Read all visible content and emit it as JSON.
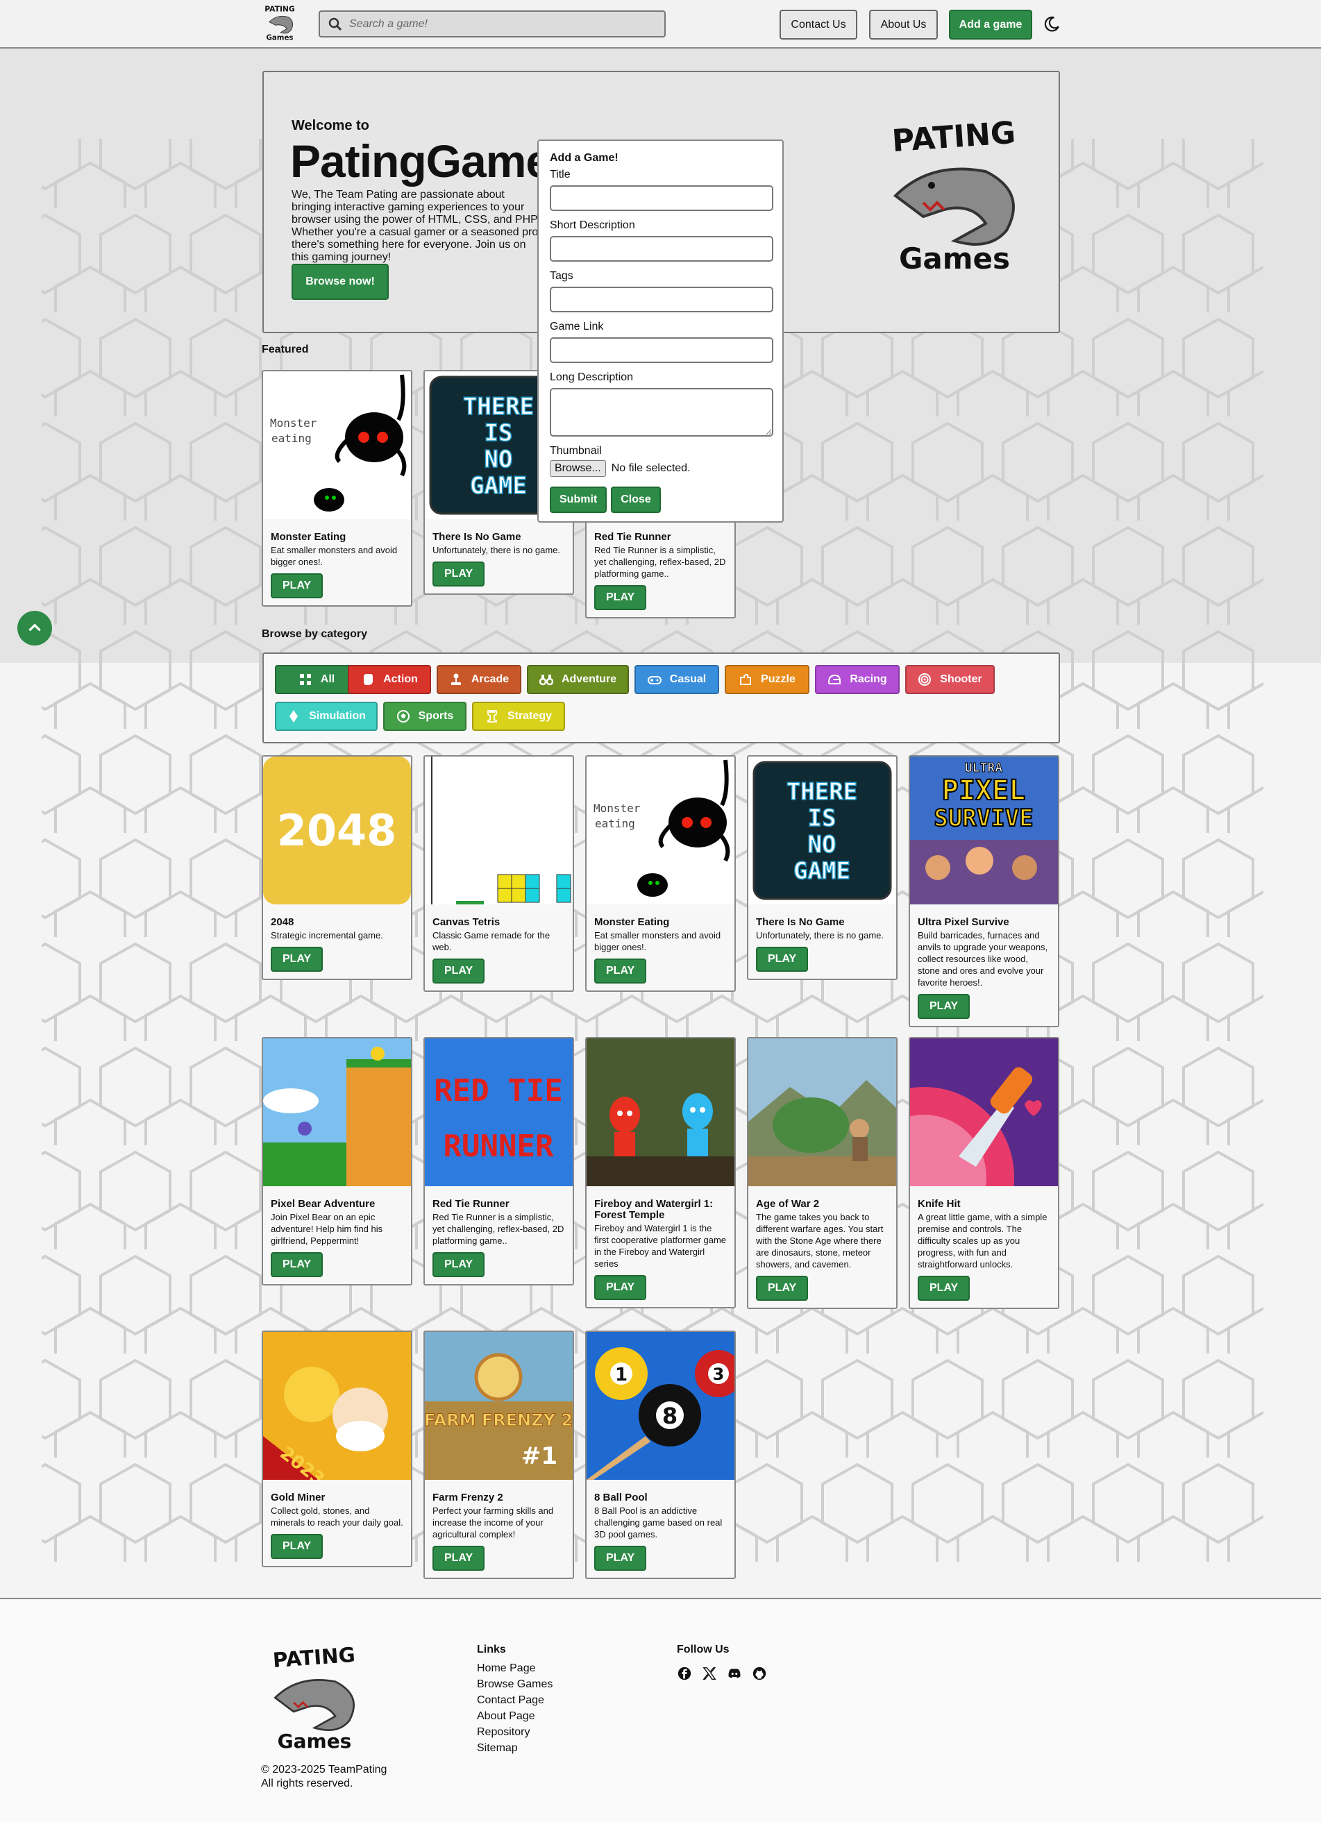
{
  "header": {
    "search_placeholder": "Search a game!",
    "contact_label": "Contact Us",
    "about_label": "About Us",
    "add_label": "Add a game"
  },
  "hero": {
    "welcome": "Welcome to",
    "title": "PatingGames",
    "text": "We, The Team Pating are passionate about bringing interactive gaming experiences to your browser using the power of HTML, CSS, and PHP. Whether you're a casual gamer or a seasoned pro, there's something here for everyone. Join us on this gaming journey!",
    "button": "Browse now!"
  },
  "modal": {
    "title": "Add a Game!",
    "label_title": "Title",
    "label_short": "Short Description",
    "label_tags": "Tags",
    "label_link": "Game Link",
    "label_long": "Long Description",
    "label_thumb": "Thumbnail",
    "browse": "Browse...",
    "no_file": "No file selected.",
    "submit": "Submit",
    "close": "Close"
  },
  "featured_label": "Featured",
  "featured": [
    {
      "title": "Monster Eating",
      "desc": "Eat smaller monsters and avoid bigger ones!.",
      "play": "PLAY"
    },
    {
      "title": "There Is No Game",
      "desc": "Unfortunately, there is no game.",
      "play": "PLAY"
    },
    {
      "title": "Red Tie Runner",
      "desc": "Red Tie Runner is a simplistic, yet challenging, reflex-based, 2D platforming game..",
      "play": "PLAY"
    }
  ],
  "browse_label": "Browse by category",
  "categories": [
    {
      "label": "All",
      "color": "#2e8b47",
      "icon": "grid-icon"
    },
    {
      "label": "Action",
      "color": "#d9342b",
      "icon": "fist-icon"
    },
    {
      "label": "Arcade",
      "color": "#c8582a",
      "icon": "joystick-icon"
    },
    {
      "label": "Adventure",
      "color": "#6b8e23",
      "icon": "binoculars-icon"
    },
    {
      "label": "Casual",
      "color": "#3a8fdd",
      "icon": "gamepad-icon"
    },
    {
      "label": "Puzzle",
      "color": "#e88a1a",
      "icon": "puzzle-icon"
    },
    {
      "label": "Racing",
      "color": "#b34fd6",
      "icon": "helmet-icon"
    },
    {
      "label": "Shooter",
      "color": "#e0505a",
      "icon": "target-icon"
    },
    {
      "label": "Simulation",
      "color": "#3fd1c4",
      "icon": "diamond-icon"
    },
    {
      "label": "Sports",
      "color": "#43a047",
      "icon": "ball-icon"
    },
    {
      "label": "Strategy",
      "color": "#d9d21a",
      "icon": "rook-icon"
    }
  ],
  "games": [
    {
      "title": "2048",
      "desc": "Strategic incremental game.",
      "play": "PLAY"
    },
    {
      "title": "Canvas Tetris",
      "desc": "Classic Game remade for the web.",
      "play": "PLAY"
    },
    {
      "title": "Monster Eating",
      "desc": "Eat smaller monsters and avoid bigger ones!.",
      "play": "PLAY"
    },
    {
      "title": "There Is No Game",
      "desc": "Unfortunately, there is no game.",
      "play": "PLAY"
    },
    {
      "title": "Ultra Pixel Survive",
      "desc": "Build barricades, furnaces and anvils to upgrade your weapons, collect resources like wood, stone and ores and evolve your favorite heroes!.",
      "play": "PLAY"
    },
    {
      "title": "Pixel Bear Adventure",
      "desc": "Join Pixel Bear on an epic adventure! Help him find his girlfriend, Peppermint!",
      "play": "PLAY"
    },
    {
      "title": "Red Tie Runner",
      "desc": "Red Tie Runner is a simplistic, yet challenging, reflex-based, 2D platforming game..",
      "play": "PLAY"
    },
    {
      "title": "Fireboy and Watergirl 1: Forest Temple",
      "desc": "Fireboy and Watergirl 1 is the first cooperative platformer game in the Fireboy and Watergirl series",
      "play": "PLAY"
    },
    {
      "title": "Age of War 2",
      "desc": "The game takes you back to different warfare ages. You start with the Stone Age where there are dinosaurs, stone, meteor showers, and cavemen.",
      "play": "PLAY"
    },
    {
      "title": "Knife Hit",
      "desc": "A great little game, with a simple premise and controls. The difficulty scales up as you progress, with fun and straightforward unlocks.",
      "play": "PLAY"
    },
    {
      "title": "Gold Miner",
      "desc": "Collect gold, stones, and minerals to reach your daily goal.",
      "play": "PLAY"
    },
    {
      "title": "Farm Frenzy 2",
      "desc": "Perfect your farming skills and increase the income of your agricultural complex!",
      "play": "PLAY"
    },
    {
      "title": "8 Ball Pool",
      "desc": "8 Ball Pool is an addictive challenging game based on real 3D pool games.",
      "play": "PLAY"
    }
  ],
  "thumb_text": {
    "t2048": "2048",
    "monster": "Monster",
    "eating": "eating",
    "there": "THERE",
    "is": "IS",
    "no": "NO",
    "game": "GAME",
    "ultra": "ULTRA",
    "pixel": "PIXEL",
    "survive": "SURVIVE",
    "red_tie": "RED TIE",
    "runner": "RUNNER",
    "year": "2023",
    "farm": "FARM FRENZY 2",
    "num1": "#1",
    "pool_1": "1",
    "pool_8": "8",
    "pool_3": "3"
  },
  "logo_text": {
    "top": "PATING",
    "bottom": "Games"
  },
  "footer": {
    "copyright": "© 2023-2025 TeamPating",
    "rights": "All rights reserved.",
    "links_head": "Links",
    "links": [
      "Home Page",
      "Browse Games",
      "Contact Page",
      "About Page",
      "Repository",
      "Sitemap"
    ],
    "follow_head": "Follow Us"
  },
  "colors": {
    "accent": "#2e8b47"
  }
}
